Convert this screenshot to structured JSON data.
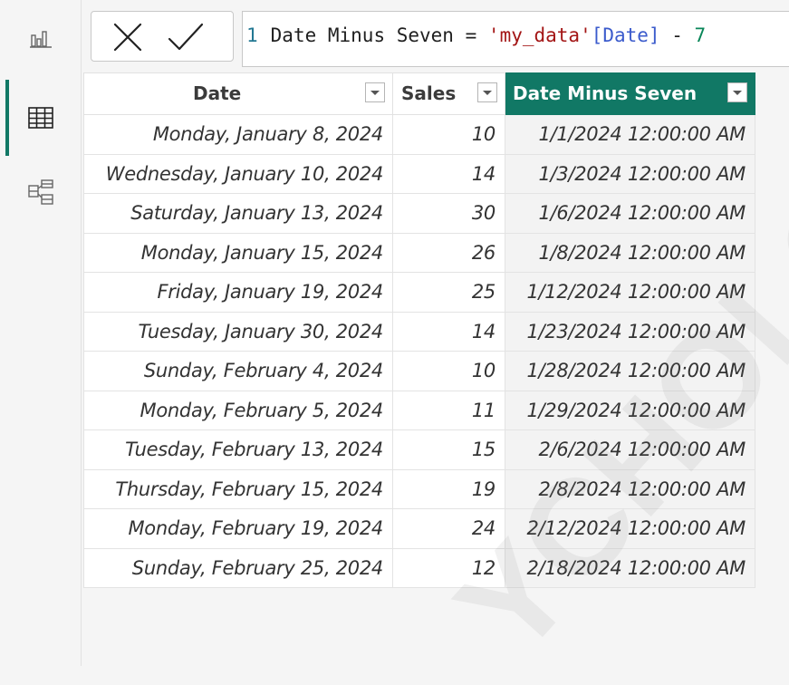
{
  "formula_bar": {
    "line_number": "1",
    "measure_name": "Date Minus Seven",
    "equals": "=",
    "table_ref": "'my_data'",
    "column_ref": "[Date]",
    "operator": "-",
    "literal": "7",
    "cancel_icon": "close-icon",
    "commit_icon": "check-icon"
  },
  "rail": {
    "items": [
      {
        "icon": "report-view-icon",
        "active": false
      },
      {
        "icon": "table-view-icon",
        "active": true
      },
      {
        "icon": "model-view-icon",
        "active": false
      }
    ]
  },
  "table": {
    "columns": [
      "Date",
      "Sales",
      "Date Minus Seven"
    ],
    "active_column": "Date Minus Seven",
    "rows": [
      [
        "Monday, January 8, 2024",
        "10",
        "1/1/2024 12:00:00 AM"
      ],
      [
        "Wednesday, January 10, 2024",
        "14",
        "1/3/2024 12:00:00 AM"
      ],
      [
        "Saturday, January 13, 2024",
        "30",
        "1/6/2024 12:00:00 AM"
      ],
      [
        "Monday, January 15, 2024",
        "26",
        "1/8/2024 12:00:00 AM"
      ],
      [
        "Friday, January 19, 2024",
        "25",
        "1/12/2024 12:00:00 AM"
      ],
      [
        "Tuesday, January 30, 2024",
        "14",
        "1/23/2024 12:00:00 AM"
      ],
      [
        "Sunday, February 4, 2024",
        "10",
        "1/28/2024 12:00:00 AM"
      ],
      [
        "Monday, February 5, 2024",
        "11",
        "1/29/2024 12:00:00 AM"
      ],
      [
        "Tuesday, February 13, 2024",
        "15",
        "2/6/2024 12:00:00 AM"
      ],
      [
        "Thursday, February 15, 2024",
        "19",
        "2/8/2024 12:00:00 AM"
      ],
      [
        "Monday, February 19, 2024",
        "24",
        "2/12/2024 12:00:00 AM"
      ],
      [
        "Sunday, February 25, 2024",
        "12",
        "2/18/2024 12:00:00 AM"
      ]
    ]
  },
  "colors": {
    "accent": "#117865",
    "string": "#a31515",
    "column_ref": "#3b5bcc",
    "number": "#098658",
    "line_number": "#237893"
  },
  "watermark": "YCHOLO"
}
